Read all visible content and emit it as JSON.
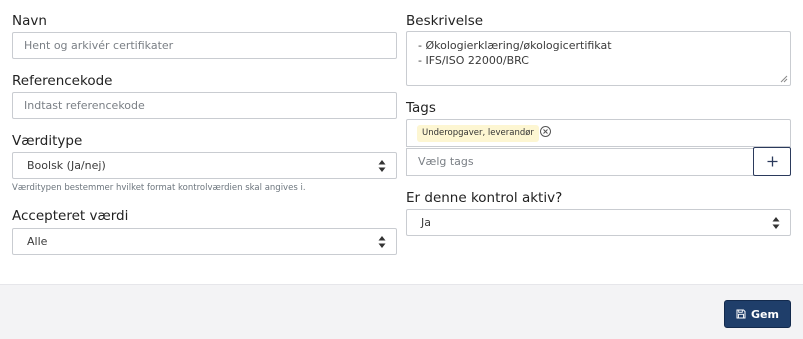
{
  "left": {
    "name": {
      "label": "Navn",
      "placeholder": "Hent og arkivér certifikater"
    },
    "reference": {
      "label": "Referencekode",
      "placeholder": "Indtast referencekode"
    },
    "value_type": {
      "label": "Værditype",
      "value": "Boolsk (Ja/nej)",
      "help": "Værditypen bestemmer hvilket format kontrolværdien skal angives i."
    },
    "accepted": {
      "label": "Accepteret værdi",
      "value": "Alle"
    }
  },
  "right": {
    "description": {
      "label": "Beskrivelse",
      "lines": [
        "- Økologierklæring/økologicertifikat",
        "- IFS/ISO 22000/BRC"
      ]
    },
    "tags": {
      "label": "Tags",
      "chip": "Underopgaver, leverandør",
      "placeholder": "Vælg tags"
    },
    "active": {
      "label": "Er denne kontrol aktiv?",
      "value": "Ja"
    }
  },
  "footer": {
    "save_label": "Gem"
  },
  "icons": {
    "add": "plus-icon",
    "remove_tag": "close-circle-icon",
    "save": "floppy-disk-icon",
    "caret": "sort-caret-icon"
  },
  "colors": {
    "primary": "#1f3e6a",
    "tag_bg": "#fdf6d2",
    "footer_bg": "#f3f3f5"
  }
}
